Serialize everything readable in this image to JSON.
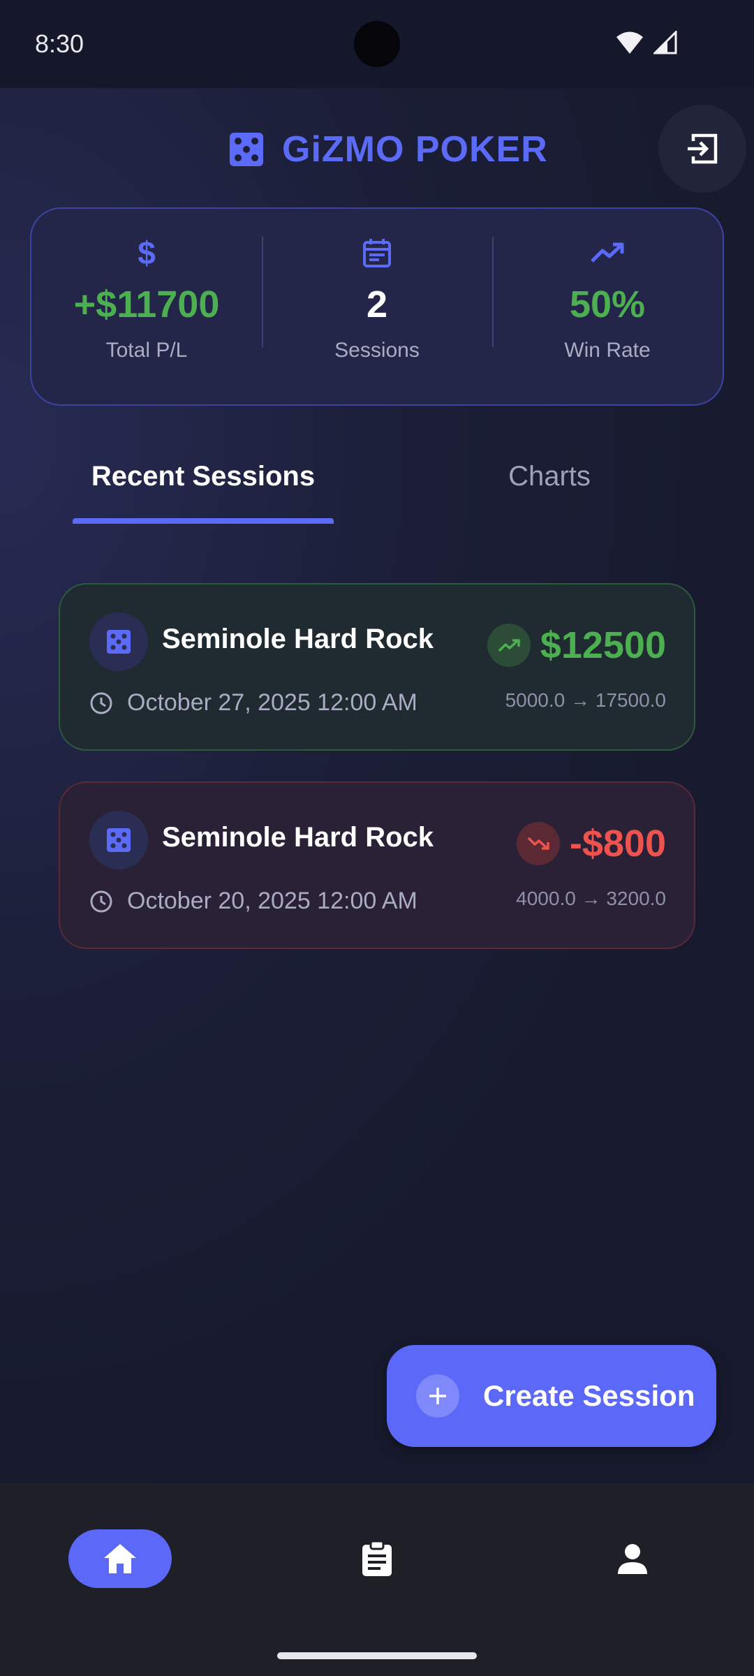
{
  "status_bar": {
    "time": "8:30"
  },
  "header": {
    "title": "GiZMO POKER",
    "logo_icon": "dice-icon",
    "logout_icon": "logout-icon"
  },
  "colors": {
    "accent": "#5b6af7",
    "profit": "#4caf50",
    "loss": "#ef5350"
  },
  "stats": [
    {
      "icon": "dollar-icon",
      "value": "+$11700",
      "label": "Total P/L"
    },
    {
      "icon": "calendar-icon",
      "value": "2",
      "label": "Sessions"
    },
    {
      "icon": "trending-up-icon",
      "value": "50%",
      "label": "Win Rate"
    }
  ],
  "tabs": [
    {
      "label": "Recent Sessions",
      "active": true
    },
    {
      "label": "Charts",
      "active": false
    }
  ],
  "sessions": [
    {
      "venue": "Seminole Hard Rock",
      "date": "October 27, 2025 12:00 AM",
      "amount": "$12500",
      "bankroll": "5000.0 → 17500.0",
      "trend": "up"
    },
    {
      "venue": "Seminole Hard Rock",
      "date": "October 20, 2025 12:00 AM",
      "amount": "-$800",
      "bankroll": "4000.0 → 3200.0",
      "trend": "down"
    }
  ],
  "fab": {
    "label": "Create Session"
  },
  "bottom_nav": [
    {
      "icon": "home-icon",
      "active": true
    },
    {
      "icon": "clipboard-icon",
      "active": false
    },
    {
      "icon": "person-icon",
      "active": false
    }
  ]
}
